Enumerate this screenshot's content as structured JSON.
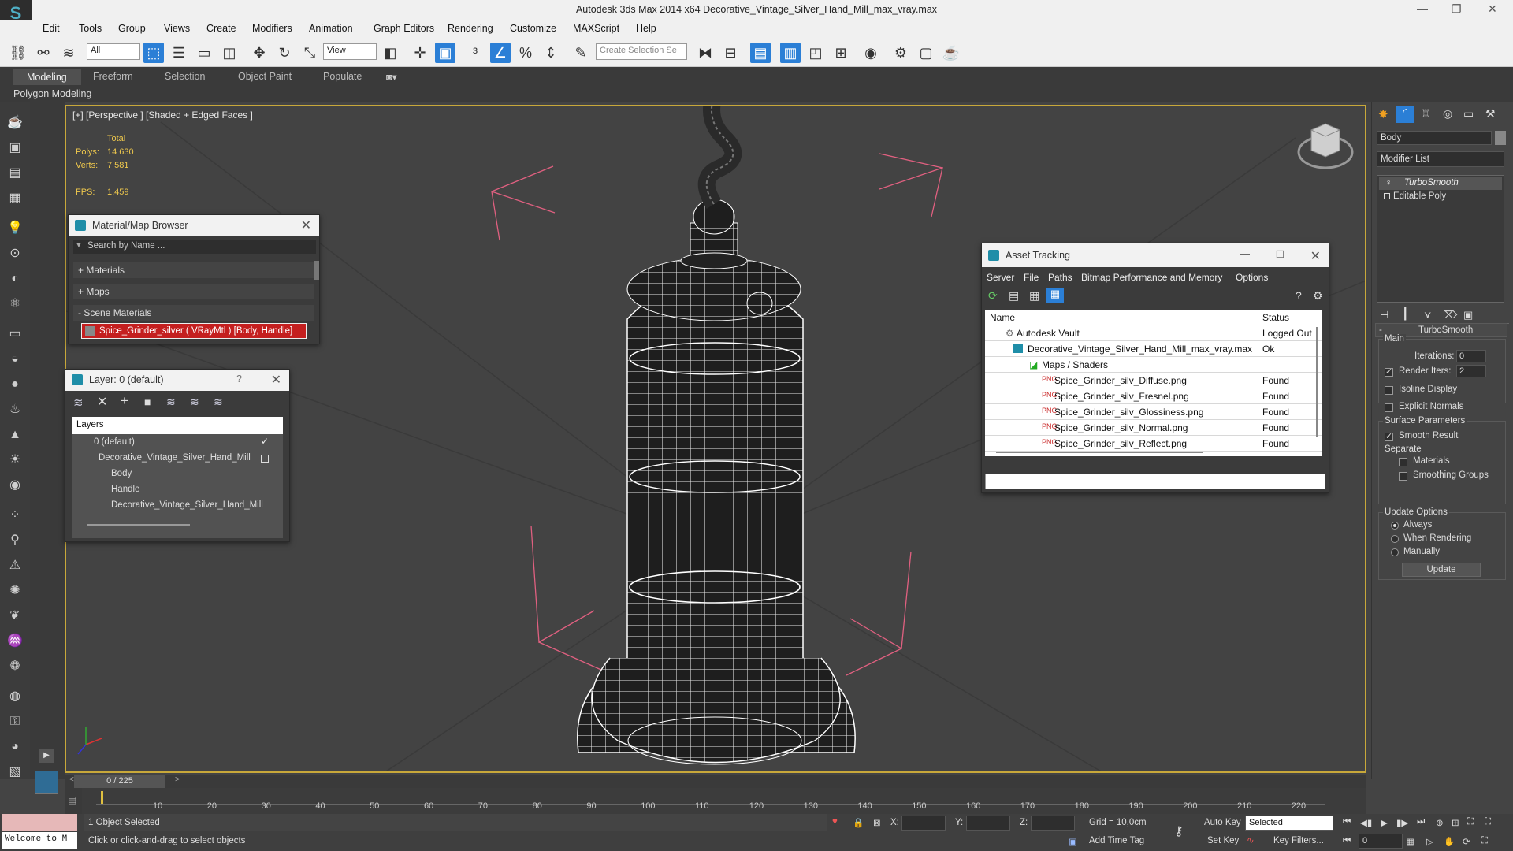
{
  "titlebar": {
    "title": "Autodesk 3ds Max  2014 x64     Decorative_Vintage_Silver_Hand_Mill_max_vray.max"
  },
  "menu": [
    "Edit",
    "Tools",
    "Group",
    "Views",
    "Create",
    "Modifiers",
    "Animation",
    "Graph Editors",
    "Rendering",
    "Customize",
    "MAXScript",
    "Help"
  ],
  "toolbar": {
    "selection_filter": "All",
    "ref_coord": "View",
    "named_selection_placeholder": "Create Selection Se"
  },
  "ribbon": {
    "tabs": [
      "Modeling",
      "Freeform",
      "Selection",
      "Object Paint",
      "Populate"
    ],
    "active_tab": "Modeling",
    "sub_label": "Polygon Modeling"
  },
  "viewport": {
    "label": "[+] [Perspective ] [Shaded + Edged Faces ]",
    "stats": {
      "total_label": "Total",
      "polys_label": "Polys:",
      "polys_value": "14 630",
      "verts_label": "Verts:",
      "verts_value": "7 581",
      "fps_label": "FPS:",
      "fps_value": "1,459"
    }
  },
  "material_browser": {
    "title": "Material/Map Browser",
    "search_placeholder": "Search by Name ...",
    "sections": [
      "+ Materials",
      "+ Maps",
      "- Scene Materials"
    ],
    "scene_material": "Spice_Grinder_silver  ( VRayMtl ) [Body, Handle]"
  },
  "layer_panel": {
    "title": "Layer: 0 (default)",
    "help": "?",
    "header": "Layers",
    "items": [
      "0 (default)",
      "Decorative_Vintage_Silver_Hand_Mill",
      "Body",
      "Handle",
      "Decorative_Vintage_Silver_Hand_Mill"
    ]
  },
  "asset_tracking": {
    "title": "Asset Tracking",
    "menu": [
      "Server",
      "File",
      "Paths",
      "Bitmap Performance and Memory",
      "Options"
    ],
    "col_name": "Name",
    "col_status": "Status",
    "rows": [
      {
        "name": "Autodesk Vault",
        "status": "Logged Out"
      },
      {
        "name": "Decorative_Vintage_Silver_Hand_Mill_max_vray.max",
        "status": "Ok"
      },
      {
        "name": "Maps / Shaders",
        "status": ""
      },
      {
        "name": "Spice_Grinder_silv_Diffuse.png",
        "status": "Found"
      },
      {
        "name": "Spice_Grinder_silv_Fresnel.png",
        "status": "Found"
      },
      {
        "name": "Spice_Grinder_silv_Glossiness.png",
        "status": "Found"
      },
      {
        "name": "Spice_Grinder_silv_Normal.png",
        "status": "Found"
      },
      {
        "name": "Spice_Grinder_silv_Reflect.png",
        "status": "Found"
      }
    ]
  },
  "command_panel": {
    "object_name": "Body",
    "modifier_list": "Modifier List",
    "stack": [
      "TurboSmooth",
      "Editable Poly"
    ],
    "rollout_title": "TurboSmooth",
    "main_label": "Main",
    "iterations_label": "Iterations:",
    "iterations_value": "0",
    "render_iters_label": "Render Iters:",
    "render_iters_value": "2",
    "isoline_label": "Isoline Display",
    "explicit_normals_label": "Explicit Normals",
    "surface_params_label": "Surface Parameters",
    "smooth_result_label": "Smooth Result",
    "separate_label": "Separate",
    "materials_label": "Materials",
    "smoothing_groups_label": "Smoothing Groups",
    "update_options_label": "Update Options",
    "always_label": "Always",
    "when_rendering_label": "When Rendering",
    "manually_label": "Manually",
    "update_button": "Update"
  },
  "timeline": {
    "frame": "0 / 225",
    "ticks": [
      "10",
      "20",
      "30",
      "40",
      "50",
      "60",
      "70",
      "80",
      "90",
      "100",
      "110",
      "120",
      "130",
      "140",
      "150",
      "160",
      "170",
      "180",
      "190",
      "200",
      "210",
      "220"
    ]
  },
  "status": {
    "maxscript": "Welcome to M",
    "selected": "1 Object Selected",
    "prompt": "Click or click-and-drag to select objects",
    "x_label": "X:",
    "y_label": "Y:",
    "z_label": "Z:",
    "grid": "Grid = 10,0cm",
    "add_time_tag": "Add Time Tag",
    "auto_key": "Auto Key",
    "set_key": "Set Key",
    "selected_dropdown": "Selected",
    "key_filters": "Key Filters...",
    "frame_field": "0"
  },
  "colors": {
    "accent_blue": "#2b7fd6",
    "viewport_border": "#c8a83a",
    "stats_yellow": "#f0c94d",
    "material_highlight": "#c41f1f"
  }
}
